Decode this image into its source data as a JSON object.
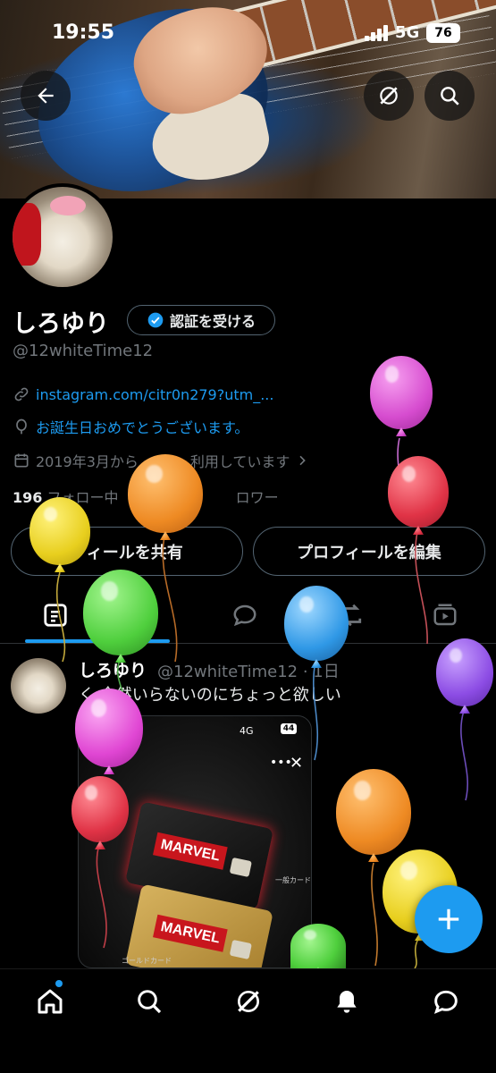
{
  "status": {
    "time": "19:55",
    "network": "5G",
    "battery": "76"
  },
  "profile": {
    "name": "しろゆり",
    "verify_label": "認証を受ける",
    "handle": "@12whiteTime12",
    "link": "instagram.com/citr0n279?utm_...",
    "birthday": "お誕生日おめでとうございます。",
    "joined": "2019年3月から",
    "joined_suffix": "利用しています",
    "following_count": "196",
    "following_label": "フォロー中",
    "followers_label": "ロワー"
  },
  "buttons": {
    "share": "フィールを共有",
    "edit": "プロフィールを編集"
  },
  "post": {
    "name": "しろゆり",
    "handle_time": "@12whiteTime12 · 1日",
    "text": "く  全然いらないのにちょっと欲しい",
    "media": {
      "status": "4G",
      "battery": "44",
      "brand": "MARVEL",
      "card1_label": "一般カード",
      "card2_label": "ゴールドカード"
    }
  },
  "colors": {
    "accent": "#1d9bf0",
    "background": "#000000"
  },
  "icons": [
    "back-arrow-icon",
    "grok-icon",
    "search-icon",
    "link-icon",
    "balloon-icon",
    "calendar-icon",
    "chevron-right-icon",
    "posts-tab-icon",
    "replies-tab-icon",
    "repost-tab-icon",
    "media-tab-icon",
    "plus-icon",
    "home-icon",
    "nav-search-icon",
    "nav-grok-icon",
    "bell-icon",
    "messages-icon"
  ]
}
